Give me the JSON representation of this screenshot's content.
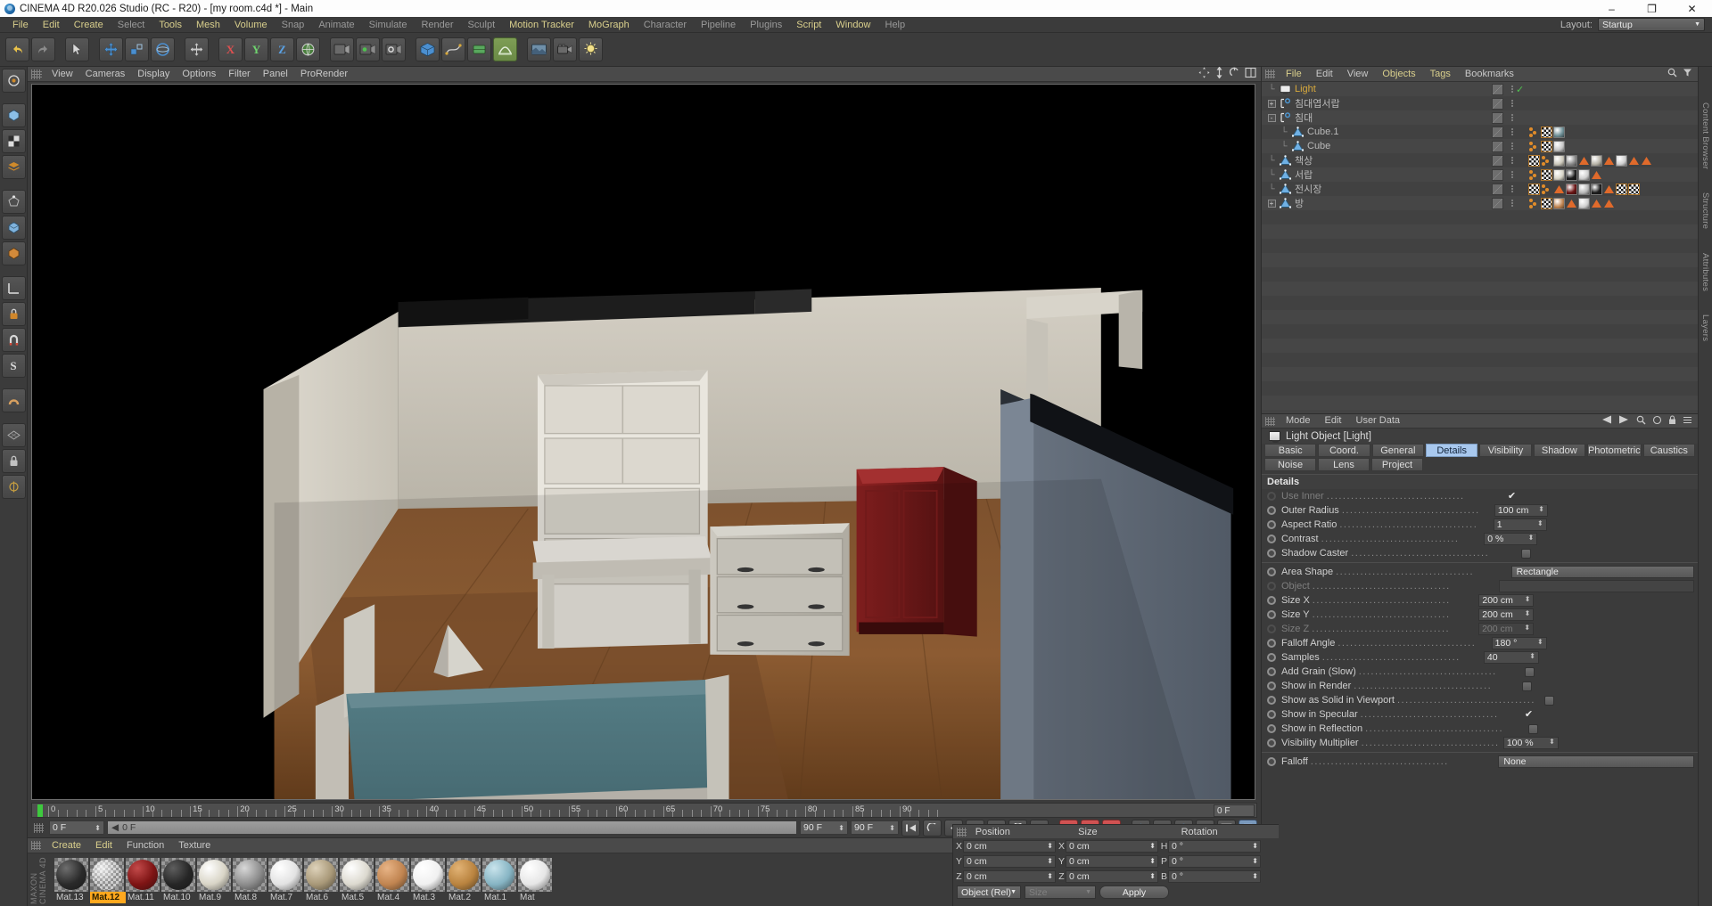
{
  "window": {
    "title": "CINEMA 4D R20.026 Studio (RC - R20) - [my room.c4d *] - Main",
    "minimize": "–",
    "maximize": "❐",
    "close": "✕"
  },
  "menubar": {
    "items": [
      {
        "label": "File",
        "hot": true
      },
      {
        "label": "Edit",
        "hot": true
      },
      {
        "label": "Create",
        "hot": true
      },
      {
        "label": "Select",
        "hot": false
      },
      {
        "label": "Tools",
        "hot": true
      },
      {
        "label": "Mesh",
        "hot": true
      },
      {
        "label": "Volume",
        "hot": true
      },
      {
        "label": "Snap",
        "hot": false
      },
      {
        "label": "Animate",
        "hot": false
      },
      {
        "label": "Simulate",
        "hot": false
      },
      {
        "label": "Render",
        "hot": false
      },
      {
        "label": "Sculpt",
        "hot": false
      },
      {
        "label": "Motion Tracker",
        "hot": true
      },
      {
        "label": "MoGraph",
        "hot": true
      },
      {
        "label": "Character",
        "hot": false
      },
      {
        "label": "Pipeline",
        "hot": false
      },
      {
        "label": "Plugins",
        "hot": false
      },
      {
        "label": "Script",
        "hot": true
      },
      {
        "label": "Window",
        "hot": true
      },
      {
        "label": "Help",
        "hot": false
      }
    ],
    "layout_label": "Layout:",
    "layout_value": "Startup"
  },
  "viewport_menu": {
    "items": [
      "View",
      "Cameras",
      "Display",
      "Options",
      "Filter",
      "Panel",
      "ProRender"
    ]
  },
  "timeline": {
    "ticks": [
      0,
      5,
      10,
      15,
      20,
      25,
      30,
      35,
      40,
      45,
      50,
      55,
      60,
      65,
      70,
      75,
      80,
      85,
      90
    ],
    "end_field": "0 F",
    "current_frame": "0 F",
    "preview_start": "0 F",
    "range_end": "90 F",
    "range_end2": "90 F"
  },
  "material_manager": {
    "menu": [
      {
        "label": "Create",
        "hot": true
      },
      {
        "label": "Edit",
        "hot": true
      },
      {
        "label": "Function",
        "hot": false
      },
      {
        "label": "Texture",
        "hot": false
      }
    ],
    "brand": "MAXON CINEMA 4D",
    "selected": "Mat.12",
    "materials": [
      {
        "name": "Mat.13",
        "color": "#2a2a2a",
        "hl": "#6e6e6e"
      },
      {
        "name": "Mat.12",
        "color": "#b9b9b9",
        "hl": "#ffffff",
        "checker": true
      },
      {
        "name": "Mat.11",
        "color": "#7e1414",
        "hl": "#c34a4a"
      },
      {
        "name": "Mat.10",
        "color": "#262626",
        "hl": "#5e5e5e"
      },
      {
        "name": "Mat.9",
        "color": "#d8d4c6",
        "hl": "#ffffff"
      },
      {
        "name": "Mat.8",
        "color": "#8d8d8d",
        "hl": "#d8d8d8"
      },
      {
        "name": "Mat.7",
        "color": "#e2e2e2",
        "hl": "#ffffff"
      },
      {
        "name": "Mat.6",
        "color": "#a89878",
        "hl": "#ded2ba"
      },
      {
        "name": "Mat.5",
        "color": "#dcd9cf",
        "hl": "#ffffff"
      },
      {
        "name": "Mat.4",
        "color": "#c08450",
        "hl": "#e8b486"
      },
      {
        "name": "Mat.3",
        "color": "#f0f0f0",
        "hl": "#ffffff"
      },
      {
        "name": "Mat.2",
        "color": "#b9833f",
        "hl": "#e2b375"
      },
      {
        "name": "Mat.1",
        "color": "#86b4c3",
        "hl": "#c9e4ec"
      },
      {
        "name": "Mat",
        "color": "#e6e6e6",
        "hl": "#ffffff"
      }
    ]
  },
  "object_manager": {
    "menu": [
      {
        "label": "File",
        "hot": true
      },
      {
        "label": "Edit",
        "hot": false
      },
      {
        "label": "View",
        "hot": false
      },
      {
        "label": "Objects",
        "hot": true
      },
      {
        "label": "Tags",
        "hot": true
      },
      {
        "label": "Bookmarks",
        "hot": false
      }
    ],
    "objects": [
      {
        "name": "Light",
        "type": "light",
        "indent": 0,
        "expander": "",
        "selected": true,
        "visible_check": true,
        "tags": []
      },
      {
        "name": "침대엽서랍",
        "type": "null",
        "indent": 0,
        "expander": "+",
        "selected": false,
        "tags": []
      },
      {
        "name": "침대",
        "type": "null",
        "indent": 0,
        "expander": "-",
        "selected": false,
        "tags": []
      },
      {
        "name": "Cube.1",
        "type": "poly",
        "indent": 1,
        "expander": "",
        "selected": false,
        "tags": [
          {
            "k": "dots"
          },
          {
            "k": "checker"
          },
          {
            "k": "mat",
            "c": "#6e8f96"
          }
        ]
      },
      {
        "name": "Cube",
        "type": "poly",
        "indent": 1,
        "expander": "",
        "selected": false,
        "tags": [
          {
            "k": "dots"
          },
          {
            "k": "checker"
          },
          {
            "k": "mat",
            "c": "#c8c8c8"
          }
        ]
      },
      {
        "name": "책상",
        "type": "poly",
        "indent": 0,
        "expander": "",
        "selected": false,
        "tags": [
          {
            "k": "checker"
          },
          {
            "k": "dots"
          },
          {
            "k": "mat",
            "c": "#ccc8bb"
          },
          {
            "k": "mat",
            "c": "#8a8a8a"
          },
          {
            "k": "tri",
            "c": "#e06a2b"
          },
          {
            "k": "mat",
            "c": "#b8b4a8"
          },
          {
            "k": "tri",
            "c": "#e06a2b"
          },
          {
            "k": "mat",
            "c": "#cfcfcf"
          },
          {
            "k": "tri",
            "c": "#e06a2b"
          },
          {
            "k": "tri",
            "c": "#e06a2b"
          }
        ]
      },
      {
        "name": "서랍",
        "type": "poly",
        "indent": 0,
        "expander": "",
        "selected": false,
        "tags": [
          {
            "k": "dots"
          },
          {
            "k": "checker"
          },
          {
            "k": "mat",
            "c": "#d8d5c8"
          },
          {
            "k": "mat",
            "c": "#1c1c1c"
          },
          {
            "k": "mat",
            "c": "#d0d0d0"
          },
          {
            "k": "tri",
            "c": "#e06a2b"
          }
        ]
      },
      {
        "name": "전시장",
        "type": "poly",
        "indent": 0,
        "expander": "",
        "selected": false,
        "tags": [
          {
            "k": "checker"
          },
          {
            "k": "dots"
          },
          {
            "k": "tri",
            "c": "#e06a2b"
          },
          {
            "k": "mat",
            "c": "#6b1414"
          },
          {
            "k": "mat",
            "c": "#b9b9b9"
          },
          {
            "k": "mat",
            "c": "#1c1c1c"
          },
          {
            "k": "tri",
            "c": "#e06a2b"
          },
          {
            "k": "checker"
          },
          {
            "k": "checker"
          }
        ]
      },
      {
        "name": "방",
        "type": "poly",
        "indent": 0,
        "expander": "+",
        "selected": false,
        "tags": [
          {
            "k": "dots"
          },
          {
            "k": "checker"
          },
          {
            "k": "mat",
            "c": "#c08450"
          },
          {
            "k": "tri",
            "c": "#e06a2b"
          },
          {
            "k": "mat",
            "c": "#cfcfcf"
          },
          {
            "k": "tri",
            "c": "#e06a2b"
          },
          {
            "k": "tri",
            "c": "#e06a2b"
          }
        ]
      }
    ]
  },
  "attribute_manager": {
    "menu": [
      "Mode",
      "Edit",
      "User Data"
    ],
    "object_title": "Light Object [Light]",
    "tabs_row1": [
      "Basic",
      "Coord.",
      "General",
      "Details",
      "Visibility",
      "Shadow",
      "Photometric",
      "Caustics"
    ],
    "tabs_row2": [
      "Noise",
      "Lens",
      "Project"
    ],
    "active_tab": "Details",
    "section_title": "Details",
    "params": [
      {
        "label": "Use Inner",
        "kind": "checkmark",
        "value": "✔",
        "dim": true,
        "radio": "off"
      },
      {
        "label": "Outer Radius",
        "kind": "field",
        "value": "100 cm",
        "radio": "on"
      },
      {
        "label": "Aspect Ratio",
        "kind": "field",
        "value": "1",
        "radio": "on"
      },
      {
        "label": "Contrast",
        "kind": "field",
        "value": "0 %",
        "radio": "on"
      },
      {
        "label": "Shadow Caster",
        "kind": "check",
        "value": "",
        "radio": "on"
      },
      {
        "label": "__div__",
        "kind": "divider"
      },
      {
        "label": "Area Shape",
        "kind": "combo",
        "value": "Rectangle",
        "radio": "on"
      },
      {
        "label": "Object",
        "kind": "combo-blank",
        "value": "",
        "dim": true,
        "radio": "off"
      },
      {
        "label": "Size X",
        "kind": "field-wide",
        "value": "200 cm",
        "radio": "on"
      },
      {
        "label": "Size Y",
        "kind": "field-wide",
        "value": "200 cm",
        "radio": "on"
      },
      {
        "label": "Size Z",
        "kind": "field-wide",
        "value": "200 cm",
        "dim": true,
        "radio": "off"
      },
      {
        "label": "Falloff Angle",
        "kind": "field-wide",
        "value": "180 °",
        "radio": "on"
      },
      {
        "label": "Samples",
        "kind": "field-wide",
        "value": "40",
        "radio": "on"
      },
      {
        "label": "Add Grain (Slow)",
        "kind": "check",
        "value": "",
        "radio": "on"
      },
      {
        "label": "Show in Render",
        "kind": "check",
        "value": "",
        "radio": "on"
      },
      {
        "label": "Show as Solid in Viewport",
        "kind": "check",
        "value": "",
        "radio": "on"
      },
      {
        "label": "Show in Specular",
        "kind": "checkmark",
        "value": "✔",
        "radio": "on"
      },
      {
        "label": "Show in Reflection",
        "kind": "check",
        "value": "",
        "radio": "on"
      },
      {
        "label": "Visibility Multiplier",
        "kind": "field-wide",
        "value": "100 %",
        "radio": "on"
      },
      {
        "label": "__div__",
        "kind": "divider"
      },
      {
        "label": "Falloff",
        "kind": "combo",
        "value": "None",
        "radio": "on"
      }
    ]
  },
  "coordinates": {
    "headers": [
      "Position",
      "Size",
      "Rotation"
    ],
    "rows": [
      {
        "axis1": "X",
        "v1": "0 cm",
        "axis2": "X",
        "v2": "0 cm",
        "axis3": "H",
        "v3": "0 °"
      },
      {
        "axis1": "Y",
        "v1": "0 cm",
        "axis2": "Y",
        "v2": "0 cm",
        "axis3": "P",
        "v3": "0 °"
      },
      {
        "axis1": "Z",
        "v1": "0 cm",
        "axis2": "Z",
        "v2": "0 cm",
        "axis3": "B",
        "v3": "0 °"
      }
    ],
    "mode_select": "Object (Rel)",
    "size_select": "Size",
    "apply_button": "Apply"
  },
  "right_dock": {
    "labels": [
      "Content Browser",
      "Structure",
      "Attributes",
      "Layers"
    ]
  }
}
